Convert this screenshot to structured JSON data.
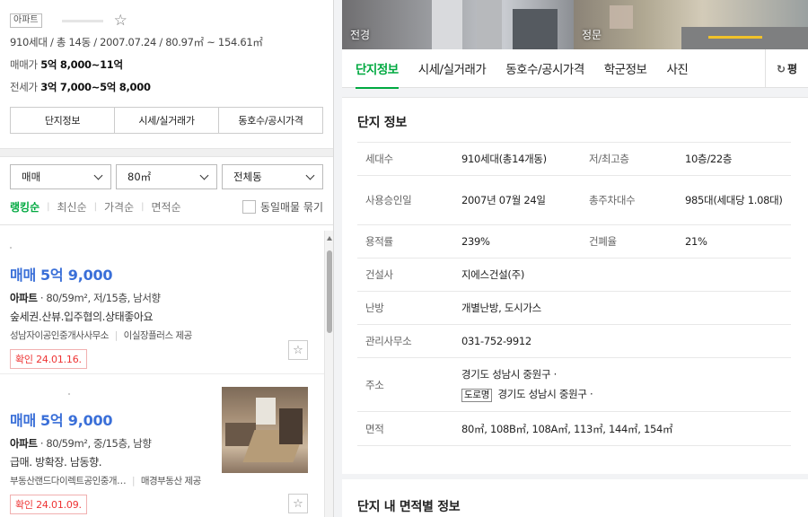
{
  "complex": {
    "type_badge": "아파트",
    "meta": "910세대 / 총 14동 / 2007.07.24 / 80.97㎡ ~ 154.61㎡",
    "sale_label": "매매가",
    "sale_value": "5억 8,000~11억",
    "jeonse_label": "전세가",
    "jeonse_value": "3억 7,000~5억 8,000"
  },
  "left_tabs": [
    "단지정보",
    "시세/실거래가",
    "동호수/공시가격"
  ],
  "filters": {
    "deal_type": "매매",
    "area": "80㎡",
    "dong": "전체동"
  },
  "sort": {
    "options": [
      "랭킹순",
      "최신순",
      "가격순",
      "면적순"
    ],
    "active": "랭킹순",
    "group_label": "동일매물 묶기"
  },
  "listings": [
    {
      "deal": "매매",
      "price": "5억 9,000",
      "type": "아파트",
      "spec": "· 80/59m², 저/15층, 남서향",
      "desc": "숲세권.산뷰.입주협의.상태좋아요",
      "agent": "성남자이공인중개사사무소",
      "provider": "이실장플러스 제공",
      "confirmed": "확인 24.01.16."
    },
    {
      "deal": "매매",
      "price": "5억 9,000",
      "type": "아파트",
      "spec": "· 80/59m², 중/15층, 남향",
      "desc": "급매. 방확장. 남동향.",
      "agent": "부동산랜드다이렉트공인중개…",
      "provider": "매경부동산 제공",
      "confirmed": "확인 24.01.09."
    }
  ],
  "photos": [
    {
      "caption": "전경"
    },
    {
      "caption": "정문"
    }
  ],
  "right_tabs": [
    "단지정보",
    "시세/실거래가",
    "동호수/공시가격",
    "학군정보",
    "사진"
  ],
  "right_tab_active": "단지정보",
  "refresh_label": "평",
  "info": {
    "title": "단지 정보",
    "rows": [
      {
        "k1": "세대수",
        "v1": "910세대(총14개동)",
        "k2": "저/최고층",
        "v2": "10층/22층"
      },
      {
        "k1": "사용승인일",
        "v1": "2007년 07월 24일",
        "k2": "총주차대수",
        "v2": "985대(세대당 1.08대)"
      },
      {
        "k1": "용적률",
        "v1": "239%",
        "k2": "건폐율",
        "v2": "21%"
      }
    ],
    "builder_label": "건설사",
    "builder": "지에스건설(주)",
    "heating_label": "난방",
    "heating": "개별난방, 도시가스",
    "office_label": "관리사무소",
    "office": "031-752-9912",
    "address_label": "주소",
    "address_jibun": "경기도 성남시 중원구 ·",
    "road_tag": "도로명",
    "address_road": "경기도 성남시 중원구 ·",
    "area_label": "면적",
    "areas": "80㎡, 108B㎡, 108A㎡, 113㎡, 144㎡, 154㎡"
  },
  "area_section_title": "단지 내 면적별 정보"
}
